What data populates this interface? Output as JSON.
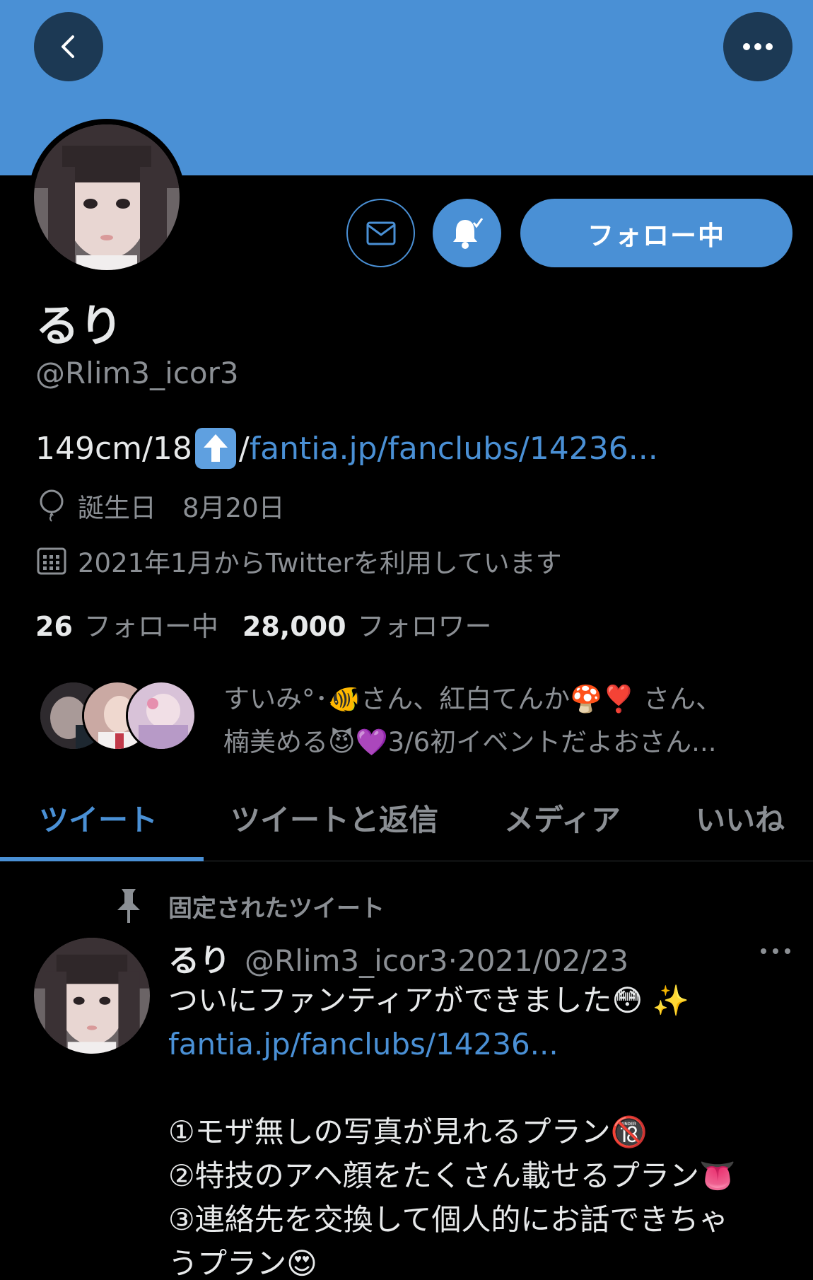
{
  "header": {
    "back_icon": "chevron-left-icon",
    "more_icon": "more-horizontal-icon",
    "banner_color": "#4a90d5"
  },
  "profile": {
    "name": "るり",
    "handle": "@Rlim3_icor3",
    "bio_prefix": "149cm/18",
    "bio_emoji": "up-arrow-emoji",
    "bio_separator": "/",
    "bio_link": "fantia.jp/fanclubs/14236...",
    "birthday_label": "誕生日　8月20日",
    "joined": "2021年1月からTwitterを利用しています",
    "following_count": "26",
    "following_label": "フォロー中",
    "followers_count": "28,000",
    "followers_label": "フォロワー",
    "known_followers_line1": "すいみ°･🐠さん、紅白てんか🍄❣️ さん、",
    "known_followers_line2": "楠美める😈💜3/6初イベントだよおさん..."
  },
  "actions": {
    "message_icon": "mail-icon",
    "notify_icon": "bell-check-icon",
    "follow_label": "フォロー中"
  },
  "tabs": [
    {
      "label": "ツイート",
      "active": true
    },
    {
      "label": "ツイートと返信",
      "active": false
    },
    {
      "label": "メディア",
      "active": false
    },
    {
      "label": "いいね",
      "active": false
    }
  ],
  "pinned_tweet": {
    "pinned_label": "固定されたツイート",
    "name": "るり",
    "handle": "@Rlim3_icor3",
    "dot": "·",
    "date": "2021/02/23",
    "line1": "ついにファンティアができました😳 ✨",
    "link": "fantia.jp/fanclubs/14236...",
    "line3": "①モザ無しの写真が見れるプラン🔞",
    "line4": "②特技のアヘ顔をたくさん載せるプラン👅",
    "line5": "③連絡先を交換して個人的にお話できちゃ",
    "line6": "うプラン😍"
  },
  "colors": {
    "accent": "#4a90d5",
    "secondary_text": "#8b8f94",
    "background": "#000000"
  }
}
